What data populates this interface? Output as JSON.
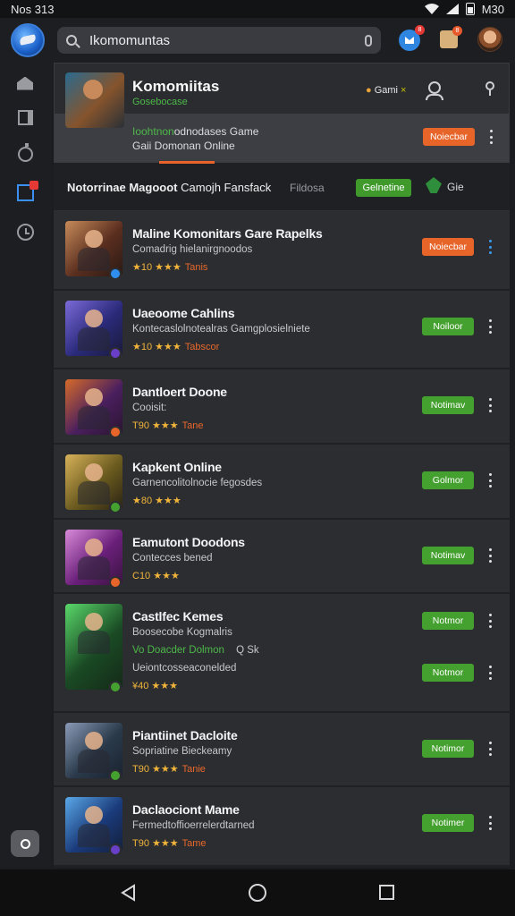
{
  "status_bar": {
    "time": "Nos 313",
    "battery_text": "M30"
  },
  "search": {
    "value": "Ikomomuntas"
  },
  "header": {
    "notif_badge": "8",
    "gift_badge": "8"
  },
  "featured": {
    "title": "Komomiitas",
    "subtitle": "Gosebocase",
    "line1_green": "Ioohtnon",
    "line1_rest": "odnodases Game",
    "line2": "Gaii Domonan Online",
    "tag": "Gami",
    "tag_mark": "×",
    "button": "Noiecbar"
  },
  "filter_bar": {
    "label_bold": "Notorrinae Magooot",
    "label_rest": "Camojh Fansfack",
    "mid_text": "Fildosa",
    "button": "Gelnetine",
    "leaf_label": "Gie"
  },
  "games": [
    {
      "title": "Maline Komonitars Gare Rapelks",
      "subtitle": "Comadrig hielanirgnoodos",
      "rating": "★10 ★★★",
      "tag": "Tanis",
      "button": "Noiecbar",
      "button_color": "orange",
      "more_color": "blue",
      "thumb_colors": [
        "#5a2e1f",
        "#c78b5a",
        "#2a1a14"
      ],
      "badge_color": "#2f8ff0"
    },
    {
      "title": "Uaeoome Cahlins",
      "subtitle": "Kontecaslolnotealras Gamgplosielniete",
      "rating": "★10 ★★★",
      "tag": "Tabscor",
      "button": "Noiloor",
      "button_color": "green",
      "more_color": "white",
      "thumb_colors": [
        "#2a2a7a",
        "#7b6ad8",
        "#1a1a3a"
      ],
      "badge_color": "#6a3fc8"
    },
    {
      "title": "Dantloert Doone",
      "subtitle": "Cooisit:",
      "rating": "T90 ★★★",
      "tag": "Tane",
      "button": "Notimav",
      "button_color": "green",
      "more_color": "white",
      "thumb_colors": [
        "#4a1f5e",
        "#d76b2a",
        "#2a1430"
      ],
      "badge_color": "#e8652a"
    },
    {
      "title": "Kapkent Online",
      "subtitle": "Garnencolitolnocie fegosdes",
      "rating": "★80 ★★★",
      "tag": "",
      "button": "Golmor",
      "button_color": "green",
      "more_color": "white",
      "thumb_colors": [
        "#6a5a1e",
        "#d8b25a",
        "#2a2414"
      ],
      "badge_color": "#45a12f"
    },
    {
      "title": "Eamutont Doodons",
      "subtitle": "Contecces bened",
      "rating": "C10 ★★★",
      "tag": "",
      "button": "Notimav",
      "button_color": "green",
      "more_color": "white",
      "thumb_colors": [
        "#6a1f7a",
        "#d88ad8",
        "#3a1440"
      ],
      "badge_color": "#e8652a"
    },
    {
      "title": "Castlfec Kemes",
      "subtitle": "Boosecobe Kogmalris",
      "green_text": "Vo Doacder Dolmon",
      "green_extra": "Q Sk",
      "subtitle2": "Ueiontcosseaconelded",
      "rating": "¥40 ★★★",
      "tag": "",
      "button": "Notmor",
      "button2": "Notmor",
      "button_color": "green",
      "more_color": "white",
      "thumb_colors": [
        "#1a4a24",
        "#5ad86a",
        "#142a18"
      ],
      "badge_color": "#45a12f"
    },
    {
      "title": "Piantiinet Dacloite",
      "subtitle": "Sopriatine Bieckeamy",
      "rating": "T90 ★★★",
      "tag": "Tanie",
      "button": "Notimor",
      "button_color": "green",
      "more_color": "white",
      "thumb_colors": [
        "#2a3a4a",
        "#8a9ab8",
        "#1a2230"
      ],
      "badge_color": "#45a12f"
    },
    {
      "title": "Daclaociont Mame",
      "subtitle": "Fermedtoffioerrelerdtarned",
      "rating": "T90 ★★★",
      "tag": "Tame",
      "button": "Notimer",
      "button_color": "green",
      "more_color": "white",
      "thumb_colors": [
        "#1a3a7a",
        "#5aa8e8",
        "#14203a"
      ],
      "badge_color": "#6a3fc8"
    }
  ]
}
